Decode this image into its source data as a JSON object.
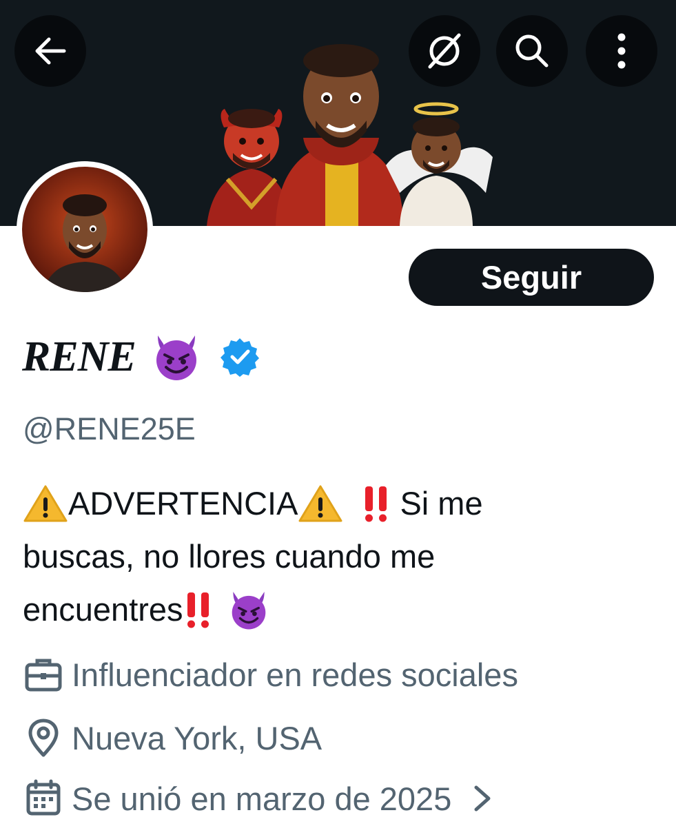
{
  "header": {
    "back_icon": "arrow-left-icon",
    "grok_icon": "grok-icon",
    "search_icon": "search-icon",
    "more_icon": "more-vertical-icon",
    "banner_colors": {
      "background": "#11181d"
    }
  },
  "profile": {
    "display_name": "RENE",
    "name_emoji": "smiling-devil-emoji",
    "verified_badge": "verified-badge-icon",
    "handle": "@RENE25E",
    "follow_label": "Seguir",
    "bio": {
      "line1_a": "ADVERTENCIA",
      "line1_b": "Si me",
      "line2": "buscas, no llores cuando me",
      "line3": "encuentres"
    }
  },
  "meta": {
    "profession": "Influenciador en redes sociales",
    "location": "Nueva York, USA",
    "joined": "Se unió en marzo de 2025"
  },
  "colors": {
    "text_primary": "#0f1419",
    "text_secondary": "#536471",
    "verified_blue": "#1d9bf0",
    "button_dark": "#0f1419",
    "warning_yellow": "#f5b82e",
    "bang_red": "#e8202a",
    "devil_purple": "#9b3fc9"
  }
}
